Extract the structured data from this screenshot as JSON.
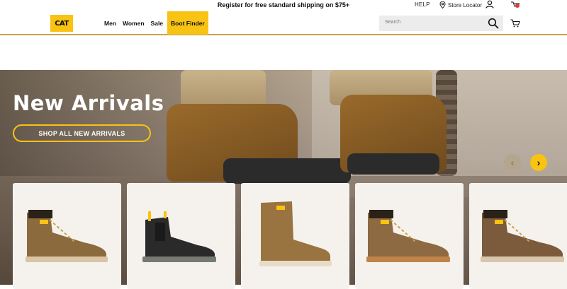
{
  "header": {
    "promo_text": "Register for free standard shipping on $75+",
    "help_label": "HELP",
    "store_locator_label": "Store Locator",
    "logo_text": "CAT",
    "nav": [
      {
        "label": "Men"
      },
      {
        "label": "Women"
      },
      {
        "label": "Sale"
      },
      {
        "label": "Boot Finder"
      }
    ],
    "search_placeholder": "Search",
    "icons": {
      "account": "account-icon",
      "notifications": "notification-icon",
      "search": "search-icon",
      "cart": "cart-icon",
      "location": "location-pin-icon"
    }
  },
  "hero": {
    "title": "New Arrivals",
    "cta_label": "SHOP ALL NEW ARRIVALS",
    "prev_arrow": "‹",
    "next_arrow": "›"
  },
  "products": [
    {
      "name": "brown lace-up work boot",
      "color": "#8b6a3e"
    },
    {
      "name": "black chelsea boot",
      "color": "#2a2a2a"
    },
    {
      "name": "tan pull-on boot",
      "color": "#9a7440"
    },
    {
      "name": "brown lace-up work boot",
      "color": "#8d6a42"
    },
    {
      "name": "brown lace-up work boot",
      "color": "#7c5a3c"
    }
  ],
  "colors": {
    "brand_yellow": "#f8c312",
    "accent_gold": "#c8a24d"
  }
}
